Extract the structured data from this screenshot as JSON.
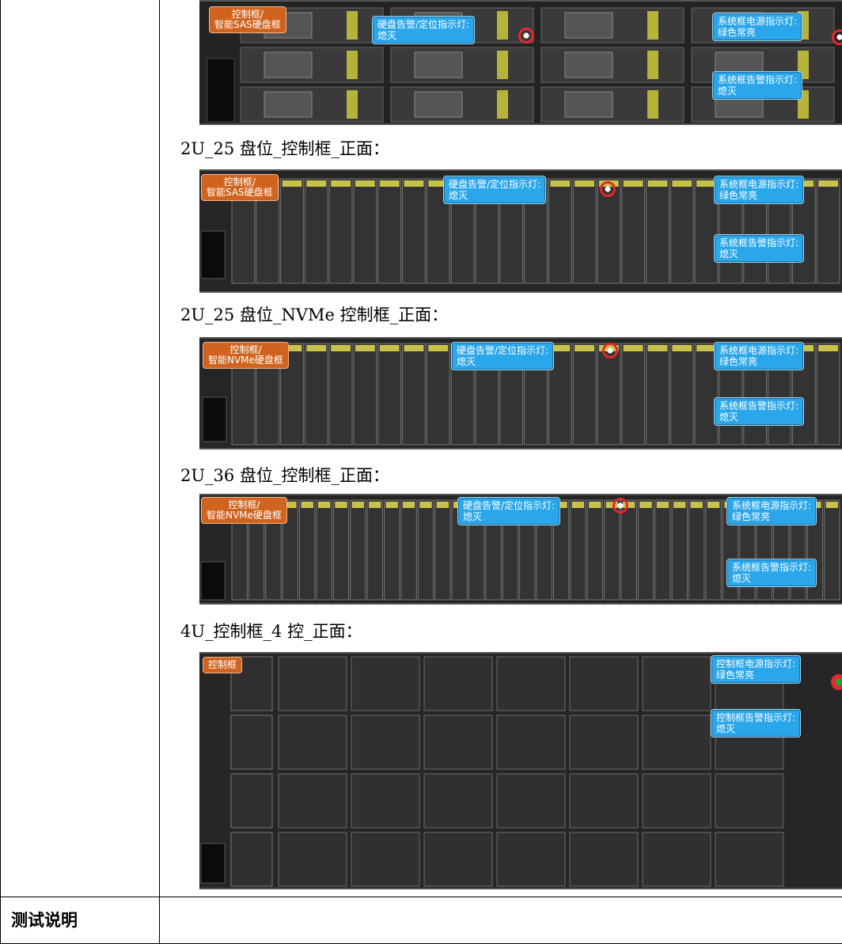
{
  "captions": {
    "c2u25": "2U_25 盘位_控制框_正面：",
    "c2u25nvme": "2U_25 盘位_NVMe 控制框_正面：",
    "c2u36": "2U_36 盘位_控制框_正面：",
    "c4u": "4U_控制框_4 控_正面："
  },
  "table": {
    "bottom_label": "测试说明"
  },
  "panels": {
    "p1": {
      "ctrl_tag": "控制框/\n智能SAS硬盘框",
      "disk_led": "硬盘告警/定位指示灯:\n熄灭",
      "power_led": "系统框电源指示灯:\n绿色常亮",
      "alarm_led": "系统框告警指示灯:\n熄灭"
    },
    "p2": {
      "ctrl_tag": "控制框/\n智能SAS硬盘框",
      "disk_led": "硬盘告警/定位指示灯:\n熄灭",
      "power_led": "系统框电源指示灯:\n绿色常亮",
      "alarm_led": "系统框告警指示灯:\n熄灭"
    },
    "p3": {
      "ctrl_tag": "控制框/\n智能NVMe硬盘框",
      "disk_led": "硬盘告警/定位指示灯:\n熄灭",
      "power_led": "系统框电源指示灯:\n绿色常亮",
      "alarm_led": "系统框告警指示灯:\n熄灭"
    },
    "p4": {
      "ctrl_tag": "控制框/\n智能NVMe硬盘框",
      "disk_led": "硬盘告警/定位指示灯:\n熄灭",
      "power_led": "系统框电源指示灯:\n绿色常亮",
      "alarm_led": "系统框告警指示灯:\n熄灭"
    },
    "p5": {
      "ctrl_tag": "控制框",
      "power_led": "控制框电源指示灯:\n绿色常亮",
      "alarm_led": "控制框告警指示灯:\n熄灭"
    }
  },
  "colors": {
    "callout": "#2aa6ea",
    "controller_tag": "#d0641f",
    "indicator_ring": "#e8262c",
    "panel": "#1b1b1b"
  }
}
